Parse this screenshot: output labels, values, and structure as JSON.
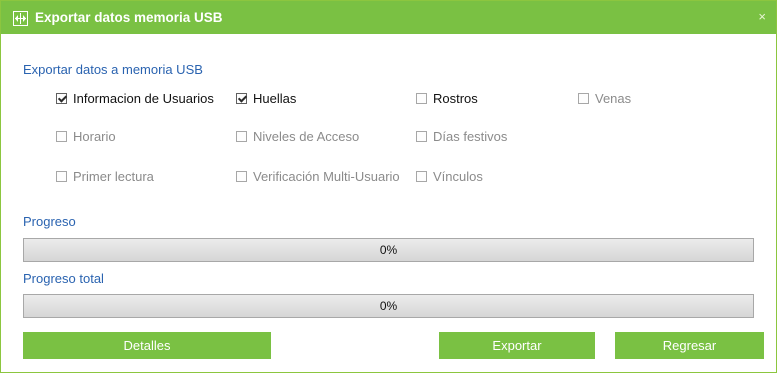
{
  "dialog": {
    "title": "Exportar datos memoria USB",
    "close_glyph": "×",
    "title_icon": "usb-export-icon"
  },
  "section": {
    "title": "Exportar datos a memoria USB"
  },
  "options": [
    {
      "label": "Informacion de Usuarios",
      "checked": true,
      "enabled": true
    },
    {
      "label": "Huellas",
      "checked": true,
      "enabled": true
    },
    {
      "label": "Rostros",
      "checked": false,
      "enabled": true
    },
    {
      "label": "Venas",
      "checked": false,
      "enabled": false
    },
    {
      "label": "Horario",
      "checked": false,
      "enabled": false
    },
    {
      "label": "Niveles de Acceso",
      "checked": false,
      "enabled": false
    },
    {
      "label": "Días festivos",
      "checked": false,
      "enabled": false
    },
    {
      "label": "Primer lectura",
      "checked": false,
      "enabled": false
    },
    {
      "label": "Verificación Multi-Usuario",
      "checked": false,
      "enabled": false
    },
    {
      "label": "Vínculos",
      "checked": false,
      "enabled": false
    }
  ],
  "progress": {
    "label": "Progreso",
    "value_text": "0%",
    "fraction": 0
  },
  "total_progress": {
    "label": "Progreso total",
    "value_text": "0%",
    "fraction": 0
  },
  "buttons": {
    "details": "Detalles",
    "export": "Exportar",
    "back": "Regresar"
  },
  "colors": {
    "accent": "#7ac143",
    "link_blue": "#2a63b0"
  }
}
